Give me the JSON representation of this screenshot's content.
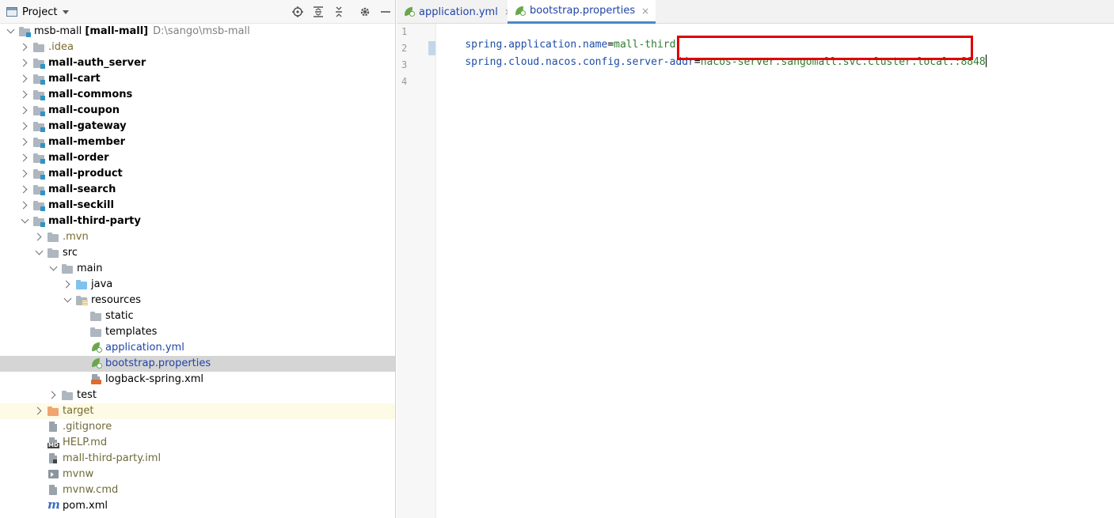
{
  "project_panel": {
    "title": "Project",
    "tools": [
      "locate-icon",
      "expand-all-icon",
      "collapse-all-icon",
      "gear-icon",
      "minimize-icon"
    ],
    "tree": [
      {
        "label": "msb-mall",
        "suffix": "[mall-mall]",
        "hint": "D:\\sango\\msb-mall",
        "icon": "module-folder",
        "depth": 0,
        "arrow": "down",
        "bold": false
      },
      {
        "label": ".idea",
        "icon": "folder",
        "depth": 1,
        "arrow": "right",
        "bold": false,
        "style": "brown"
      },
      {
        "label": "mall-auth_server",
        "icon": "module-folder",
        "depth": 1,
        "arrow": "right",
        "bold": true
      },
      {
        "label": "mall-cart",
        "icon": "module-folder",
        "depth": 1,
        "arrow": "right",
        "bold": true
      },
      {
        "label": "mall-commons",
        "icon": "module-folder",
        "depth": 1,
        "arrow": "right",
        "bold": true
      },
      {
        "label": "mall-coupon",
        "icon": "module-folder",
        "depth": 1,
        "arrow": "right",
        "bold": true
      },
      {
        "label": "mall-gateway",
        "icon": "module-folder",
        "depth": 1,
        "arrow": "right",
        "bold": true
      },
      {
        "label": "mall-member",
        "icon": "module-folder",
        "depth": 1,
        "arrow": "right",
        "bold": true
      },
      {
        "label": "mall-order",
        "icon": "module-folder",
        "depth": 1,
        "arrow": "right",
        "bold": true
      },
      {
        "label": "mall-product",
        "icon": "module-folder",
        "depth": 1,
        "arrow": "right",
        "bold": true
      },
      {
        "label": "mall-search",
        "icon": "module-folder",
        "depth": 1,
        "arrow": "right",
        "bold": true
      },
      {
        "label": "mall-seckill",
        "icon": "module-folder",
        "depth": 1,
        "arrow": "right",
        "bold": true
      },
      {
        "label": "mall-third-party",
        "icon": "module-folder",
        "depth": 1,
        "arrow": "down",
        "bold": true
      },
      {
        "label": ".mvn",
        "icon": "folder",
        "depth": 2,
        "arrow": "right",
        "bold": false,
        "style": "brown"
      },
      {
        "label": "src",
        "icon": "folder",
        "depth": 2,
        "arrow": "down",
        "bold": false
      },
      {
        "label": "main",
        "icon": "folder",
        "depth": 3,
        "arrow": "down",
        "bold": false
      },
      {
        "label": "java",
        "icon": "source-folder",
        "depth": 4,
        "arrow": "right",
        "bold": false
      },
      {
        "label": "resources",
        "icon": "resources-folder",
        "depth": 4,
        "arrow": "down",
        "bold": false
      },
      {
        "label": "static",
        "icon": "folder",
        "depth": 5,
        "arrow": "none",
        "bold": false
      },
      {
        "label": "templates",
        "icon": "folder",
        "depth": 5,
        "arrow": "none",
        "bold": false
      },
      {
        "label": "application.yml",
        "icon": "spring-file",
        "depth": 5,
        "arrow": "none",
        "bold": false,
        "style": "link"
      },
      {
        "label": "bootstrap.properties",
        "icon": "spring-file",
        "depth": 5,
        "arrow": "none",
        "bold": false,
        "style": "link",
        "selected": true
      },
      {
        "label": "logback-spring.xml",
        "icon": "xml-file",
        "depth": 5,
        "arrow": "none",
        "bold": false
      },
      {
        "label": "test",
        "icon": "folder",
        "depth": 3,
        "arrow": "right",
        "bold": false
      },
      {
        "label": "target",
        "icon": "excluded-folder",
        "depth": 2,
        "arrow": "right",
        "bold": false,
        "style": "brown",
        "highlight": true
      },
      {
        "label": ".gitignore",
        "icon": "text-file",
        "depth": 2,
        "arrow": "none",
        "bold": false,
        "style": "olive"
      },
      {
        "label": "HELP.md",
        "icon": "md-file",
        "depth": 2,
        "arrow": "none",
        "bold": false,
        "style": "olive"
      },
      {
        "label": "mall-third-party.iml",
        "icon": "iml-file",
        "depth": 2,
        "arrow": "none",
        "bold": false,
        "style": "olive"
      },
      {
        "label": "mvnw",
        "icon": "shell-file",
        "depth": 2,
        "arrow": "none",
        "bold": false,
        "style": "olive"
      },
      {
        "label": "mvnw.cmd",
        "icon": "text-file",
        "depth": 2,
        "arrow": "none",
        "bold": false,
        "style": "olive"
      },
      {
        "label": "pom.xml",
        "icon": "maven-file",
        "depth": 2,
        "arrow": "none",
        "bold": false
      }
    ]
  },
  "editor": {
    "tabs": [
      {
        "label": "application.yml",
        "active": false,
        "close": "×"
      },
      {
        "label": "bootstrap.properties",
        "active": true,
        "close": "×"
      }
    ],
    "line_numbers": [
      "1",
      "2",
      "3",
      "4"
    ],
    "lines": [
      {
        "key": "spring.application.name",
        "sep": "=",
        "value": "mall-third"
      },
      {
        "key": "spring.cloud.nacos.config.server-addr",
        "sep": "=",
        "value": "nacos-server.sangomall.svc.cluster.local.:8848"
      }
    ]
  },
  "colors": {
    "accent": "#4a88c7",
    "annotation_box": "#e00000",
    "key": "#1f4ea6",
    "value": "#2f7d2f",
    "selection": "#d5d5d5"
  }
}
